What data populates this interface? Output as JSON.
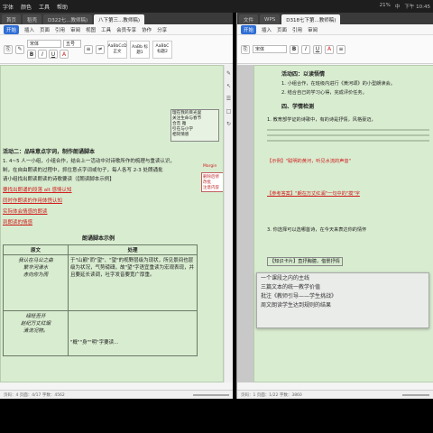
{
  "menubar": {
    "items": [
      "字体",
      "颜色",
      "工具",
      "帮助"
    ],
    "right": [
      "21%",
      "中",
      "下午 10:45"
    ]
  },
  "left_window": {
    "tabs": [
      "首页",
      "稻壳",
      "D322七...教师稿)",
      "八下第三...教师稿)"
    ],
    "ribbon_tabs": [
      "开始",
      "插入",
      "页面",
      "引用",
      "审阅",
      "视图",
      "工具",
      "会员专享",
      "协作",
      "分享"
    ],
    "font_name": "宋体",
    "font_size": "五号",
    "styles": [
      "AaBbCcD 正文",
      "AaBb 标题1",
      "AaBbC 标题2"
    ],
    "right_box": "理在我的目光里\n关注生命与春节\n合音 雅\n引在与小学\n相同情感",
    "margin_label": "Margin",
    "margin_comment": "删除后修改批\n注意内容",
    "lines": {
      "l1": "活动二：品味意点字词，制作朗诵脚本",
      "l2": "1. 4~5 人一小组，小组合作，结合上一活动中对诗歌所作的梳理与重读认识，",
      "l3": "制，在自由朗读的过程中，抓住意点字词或句子，每人各写 2-3 处朗诵批",
      "l4": "请小组找出朗读朗读的诗歌要读（【朗读脚本示例】",
      "l5": "要找出朗诵的段落 alt 感情认知",
      "l6": "同时作朗读的作用体悟认知",
      "l7": "实际体会情感的朗读",
      "l8": "到朗读的情感",
      "l9": "朗诵脚本示例"
    },
    "table": {
      "headers": [
        "原文",
        "处理"
      ],
      "rows": [
        [
          "我认在马公之曲\n繁华河清水\n赤向你为而",
          "于\"山巅\"而\"望\"、\"望\"的视野层级为现状，所见景间也层级为状况，气势磅礴，故\"望\"字语宜重读为宏观表现，并且要延长读调，吐字发音要宽广厚重。"
        ],
        [
          "绿旺吾开\n赵纪万丈红烟\n清流况物。",
          "\"概\"\"身\"\"明\"字要读..."
        ]
      ]
    },
    "status": "页码：4  页面：4/17  字数：4562"
  },
  "right_window": {
    "tabs": [
      "文件",
      "WPS",
      "D318七下第...教师稿)"
    ],
    "ribbon_tabs": [
      "开始",
      "插入",
      "页面",
      "引用",
      "审阅"
    ],
    "font_name": "宋体",
    "lines": {
      "r1": "活动四：以读悟情",
      "r2": "1. 小组合作，在班级内进行《黄河颂》的小型朗读会。",
      "r3": "2. 结合自己的学习心得，完成评价任务。",
      "r4": "四、学情检测",
      "r5": "1. 教育部学证的诗歌中，有的诗是抒情，风格豪迈，",
      "r6": "【示例】\"聪明的黄河，听见水流的声音\"",
      "r7": "【参考答案】\"朗在万丈红澜\"一句中的\"摸\"字",
      "r8": "3. 你选择可以选哪首诗，在今天来表达你的情怀",
      "r9": "【知识卡片】直抒胸臆，借景抒情"
    },
    "status": "页码：1  页面：1/22  字数：3860"
  },
  "popup": {
    "lines": [
      "一个课段之内的主线",
      "三篇文本的统一教学价值",
      "批注《教师引导——学生挑战》",
      "周文朗读学生达到规则的结果"
    ]
  }
}
